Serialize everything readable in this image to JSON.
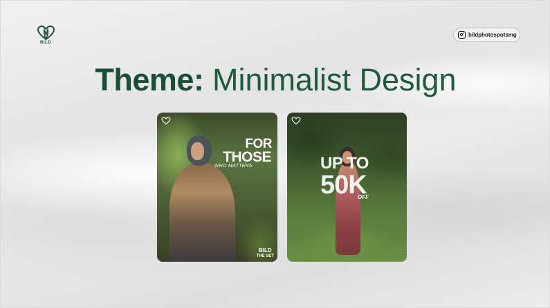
{
  "brand": {
    "logo_text": "BILD",
    "icon": "heart-leaf-logo-icon",
    "color": "#1d5a3e"
  },
  "instagram": {
    "icon": "instagram-icon",
    "handle": "bildphotospotsmg"
  },
  "title": {
    "bold": "Theme:",
    "light": "Minimalist Design"
  },
  "cards": [
    {
      "line1": "FOR",
      "line2": "THOSE",
      "line3": "WHO MATTERS",
      "badge_line1": "BILD",
      "badge_line2": "THE SET"
    },
    {
      "line1": "UP TO",
      "line2": "50K",
      "line3": "OFF",
      "side_note": ". . . .",
      "bottom_note_1": ". . . .",
      "bottom_note_2": ". . . .",
      "bottom_note_3": ". . . ."
    }
  ]
}
